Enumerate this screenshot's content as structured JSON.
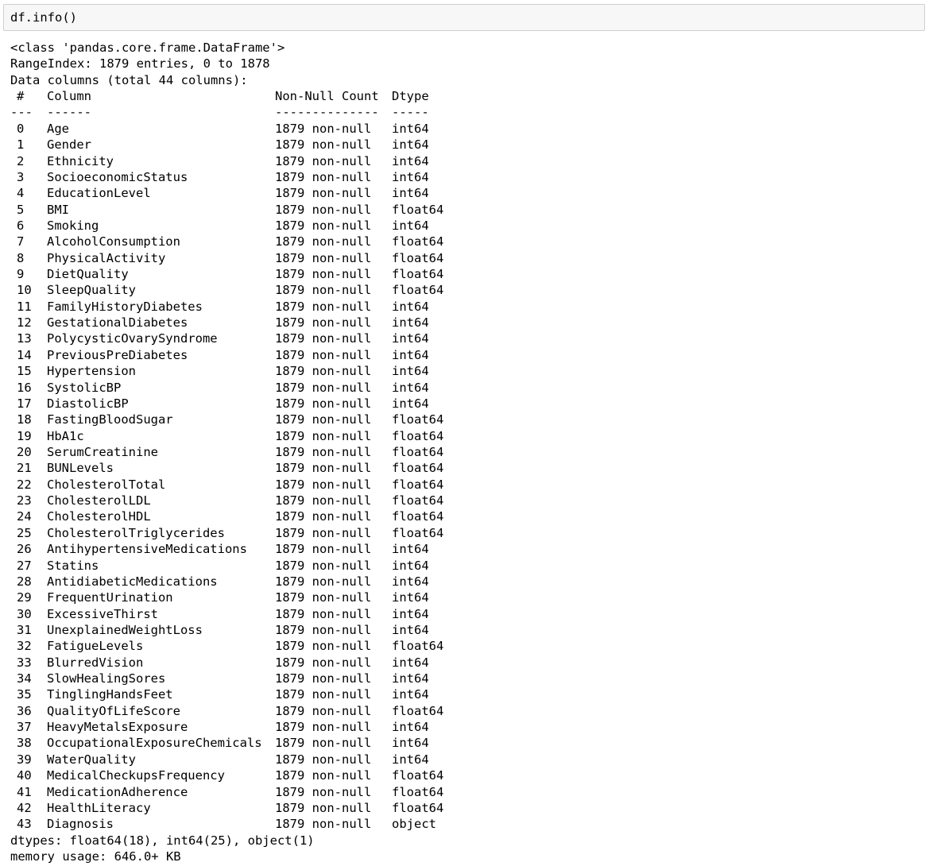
{
  "input": {
    "code": "df.info()"
  },
  "output": {
    "class_line": "<class 'pandas.core.frame.DataFrame'>",
    "range_index": "RangeIndex: 1879 entries, 0 to 1878",
    "data_columns": "Data columns (total 44 columns):",
    "header": {
      "num": "#",
      "column": "Column",
      "count": "Non-Null Count",
      "dtype": "Dtype"
    },
    "separator": {
      "num": "---",
      "column": "------",
      "count": "--------------",
      "dtype": "-----"
    },
    "rows": [
      {
        "idx": "0",
        "name": "Age",
        "count": "1879 non-null",
        "dtype": "int64"
      },
      {
        "idx": "1",
        "name": "Gender",
        "count": "1879 non-null",
        "dtype": "int64"
      },
      {
        "idx": "2",
        "name": "Ethnicity",
        "count": "1879 non-null",
        "dtype": "int64"
      },
      {
        "idx": "3",
        "name": "SocioeconomicStatus",
        "count": "1879 non-null",
        "dtype": "int64"
      },
      {
        "idx": "4",
        "name": "EducationLevel",
        "count": "1879 non-null",
        "dtype": "int64"
      },
      {
        "idx": "5",
        "name": "BMI",
        "count": "1879 non-null",
        "dtype": "float64"
      },
      {
        "idx": "6",
        "name": "Smoking",
        "count": "1879 non-null",
        "dtype": "int64"
      },
      {
        "idx": "7",
        "name": "AlcoholConsumption",
        "count": "1879 non-null",
        "dtype": "float64"
      },
      {
        "idx": "8",
        "name": "PhysicalActivity",
        "count": "1879 non-null",
        "dtype": "float64"
      },
      {
        "idx": "9",
        "name": "DietQuality",
        "count": "1879 non-null",
        "dtype": "float64"
      },
      {
        "idx": "10",
        "name": "SleepQuality",
        "count": "1879 non-null",
        "dtype": "float64"
      },
      {
        "idx": "11",
        "name": "FamilyHistoryDiabetes",
        "count": "1879 non-null",
        "dtype": "int64"
      },
      {
        "idx": "12",
        "name": "GestationalDiabetes",
        "count": "1879 non-null",
        "dtype": "int64"
      },
      {
        "idx": "13",
        "name": "PolycysticOvarySyndrome",
        "count": "1879 non-null",
        "dtype": "int64"
      },
      {
        "idx": "14",
        "name": "PreviousPreDiabetes",
        "count": "1879 non-null",
        "dtype": "int64"
      },
      {
        "idx": "15",
        "name": "Hypertension",
        "count": "1879 non-null",
        "dtype": "int64"
      },
      {
        "idx": "16",
        "name": "SystolicBP",
        "count": "1879 non-null",
        "dtype": "int64"
      },
      {
        "idx": "17",
        "name": "DiastolicBP",
        "count": "1879 non-null",
        "dtype": "int64"
      },
      {
        "idx": "18",
        "name": "FastingBloodSugar",
        "count": "1879 non-null",
        "dtype": "float64"
      },
      {
        "idx": "19",
        "name": "HbA1c",
        "count": "1879 non-null",
        "dtype": "float64"
      },
      {
        "idx": "20",
        "name": "SerumCreatinine",
        "count": "1879 non-null",
        "dtype": "float64"
      },
      {
        "idx": "21",
        "name": "BUNLevels",
        "count": "1879 non-null",
        "dtype": "float64"
      },
      {
        "idx": "22",
        "name": "CholesterolTotal",
        "count": "1879 non-null",
        "dtype": "float64"
      },
      {
        "idx": "23",
        "name": "CholesterolLDL",
        "count": "1879 non-null",
        "dtype": "float64"
      },
      {
        "idx": "24",
        "name": "CholesterolHDL",
        "count": "1879 non-null",
        "dtype": "float64"
      },
      {
        "idx": "25",
        "name": "CholesterolTriglycerides",
        "count": "1879 non-null",
        "dtype": "float64"
      },
      {
        "idx": "26",
        "name": "AntihypertensiveMedications",
        "count": "1879 non-null",
        "dtype": "int64"
      },
      {
        "idx": "27",
        "name": "Statins",
        "count": "1879 non-null",
        "dtype": "int64"
      },
      {
        "idx": "28",
        "name": "AntidiabeticMedications",
        "count": "1879 non-null",
        "dtype": "int64"
      },
      {
        "idx": "29",
        "name": "FrequentUrination",
        "count": "1879 non-null",
        "dtype": "int64"
      },
      {
        "idx": "30",
        "name": "ExcessiveThirst",
        "count": "1879 non-null",
        "dtype": "int64"
      },
      {
        "idx": "31",
        "name": "UnexplainedWeightLoss",
        "count": "1879 non-null",
        "dtype": "int64"
      },
      {
        "idx": "32",
        "name": "FatigueLevels",
        "count": "1879 non-null",
        "dtype": "float64"
      },
      {
        "idx": "33",
        "name": "BlurredVision",
        "count": "1879 non-null",
        "dtype": "int64"
      },
      {
        "idx": "34",
        "name": "SlowHealingSores",
        "count": "1879 non-null",
        "dtype": "int64"
      },
      {
        "idx": "35",
        "name": "TinglingHandsFeet",
        "count": "1879 non-null",
        "dtype": "int64"
      },
      {
        "idx": "36",
        "name": "QualityOfLifeScore",
        "count": "1879 non-null",
        "dtype": "float64"
      },
      {
        "idx": "37",
        "name": "HeavyMetalsExposure",
        "count": "1879 non-null",
        "dtype": "int64"
      },
      {
        "idx": "38",
        "name": "OccupationalExposureChemicals",
        "count": "1879 non-null",
        "dtype": "int64"
      },
      {
        "idx": "39",
        "name": "WaterQuality",
        "count": "1879 non-null",
        "dtype": "int64"
      },
      {
        "idx": "40",
        "name": "MedicalCheckupsFrequency",
        "count": "1879 non-null",
        "dtype": "float64"
      },
      {
        "idx": "41",
        "name": "MedicationAdherence",
        "count": "1879 non-null",
        "dtype": "float64"
      },
      {
        "idx": "42",
        "name": "HealthLiteracy",
        "count": "1879 non-null",
        "dtype": "float64"
      },
      {
        "idx": "43",
        "name": "Diagnosis",
        "count": "1879 non-null",
        "dtype": "object"
      }
    ],
    "dtypes_line": "dtypes: float64(18), int64(25), object(1)",
    "memory_line": "memory usage: 646.0+ KB"
  }
}
